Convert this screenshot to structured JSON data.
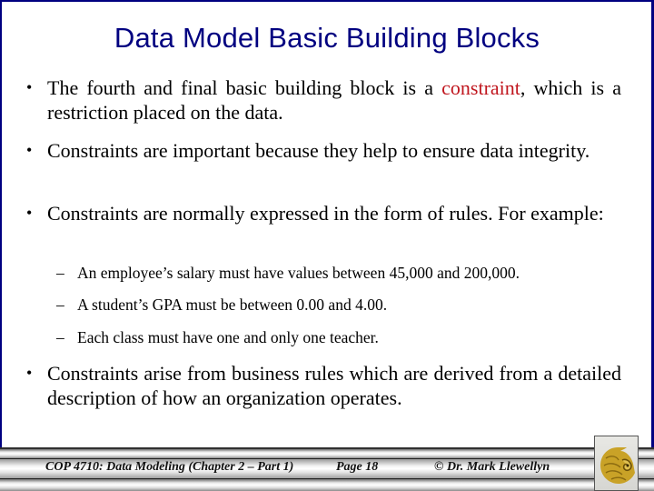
{
  "slide": {
    "title": "Data Model Basic Building Blocks",
    "bullets": [
      {
        "pre": "The fourth and final basic building block is a ",
        "highlight": "constraint",
        "post": ", which is a restriction placed on the data.",
        "highlight_color": "#c0161e"
      },
      {
        "text": "Constraints are important because they help to ensure data integrity."
      },
      {
        "text": "Constraints are normally expressed in the form of rules.  For example:"
      },
      {
        "text": "Constraints arise from business rules which are derived from a detailed description of how an organization operates."
      }
    ],
    "examples": [
      "An employee’s salary must have values between 45,000 and 200,000.",
      "A student’s GPA must be between 0.00 and 4.00.",
      "Each class must have one and only one teacher."
    ],
    "bullet_glyph": "•",
    "dash_glyph": "–"
  },
  "footer": {
    "course": "COP 4710: Data Modeling (Chapter 2 – Part 1)",
    "page": "Page 18",
    "author": "© Dr. Mark Llewellyn",
    "logo_icon": "pegasus-logo-icon"
  },
  "colors": {
    "title": "#000080",
    "border": "#000080",
    "highlight": "#c0161e",
    "logo_gold": "#c9a227"
  }
}
